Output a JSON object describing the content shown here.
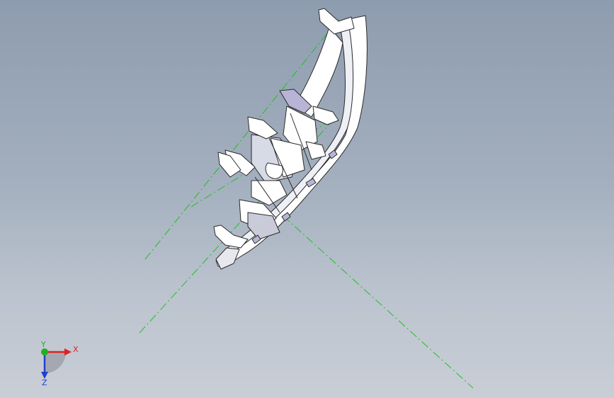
{
  "viewport": {
    "background_top": "#8e9caf",
    "background_bottom": "#c9ced6"
  },
  "model": {
    "part_color": "#ffffff",
    "edge_color": "#2a2a2a",
    "shade_color": "#d7dbe6",
    "accent_color": "#b8b4d6",
    "centerline_color": "#22c022"
  },
  "triad": {
    "x_label": "X",
    "y_label": "Y",
    "z_label": "Z",
    "x_color": "#e02020",
    "y_color": "#20b020",
    "z_color": "#2040d0"
  }
}
